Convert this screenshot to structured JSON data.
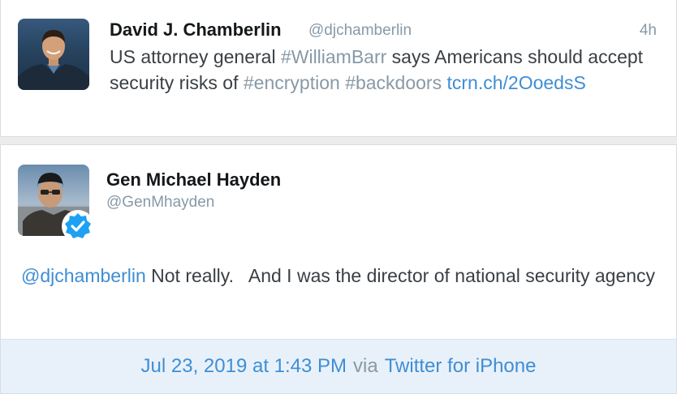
{
  "tweet1": {
    "name": "David J. Chamberlin",
    "handle": "@djchamberlin",
    "time": "4h",
    "text_part1": "US attorney general ",
    "hashtag_barr": "#WilliamBarr",
    "text_part2": " says Americans should accept security risks of ",
    "hashtag_encryption": "#encryption",
    "text_space": " ",
    "hashtag_backdoors": "#backdoors",
    "link": "tcrn.ch/2OoedsS"
  },
  "tweet2": {
    "name": "Gen Michael Hayden",
    "handle": "@GenMhayden",
    "mention": "@djchamberlin",
    "text": " Not really.   And I was the director of national security agency"
  },
  "footer": {
    "date": "Jul 23, 2019 at 1:43 PM",
    "via": "via",
    "source": "Twitter for iPhone"
  },
  "colors": {
    "link": "#3f8ed3",
    "hashtag": "#8899a6",
    "verified": "#1da1f2"
  },
  "icons": {
    "verified": "verified-badge-icon"
  }
}
